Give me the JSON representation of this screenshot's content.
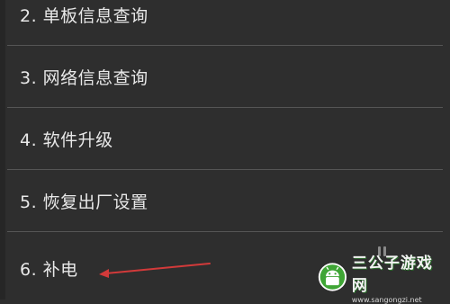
{
  "menu": {
    "items": [
      {
        "label": "2. 单板信息查询"
      },
      {
        "label": "3. 网络信息查询"
      },
      {
        "label": "4. 软件升级"
      },
      {
        "label": "5. 恢复出厂设置"
      },
      {
        "label": "6. 补电"
      }
    ]
  },
  "annotation": {
    "arrow_color": "#d23a3a"
  },
  "watermark": {
    "name": "三公子游戏网",
    "url": "www.sangongzi.net",
    "icon": "android-robot-icon"
  },
  "colors": {
    "background": "#2e2e2e",
    "text": "#e8e8e8",
    "divider": "#555555"
  }
}
